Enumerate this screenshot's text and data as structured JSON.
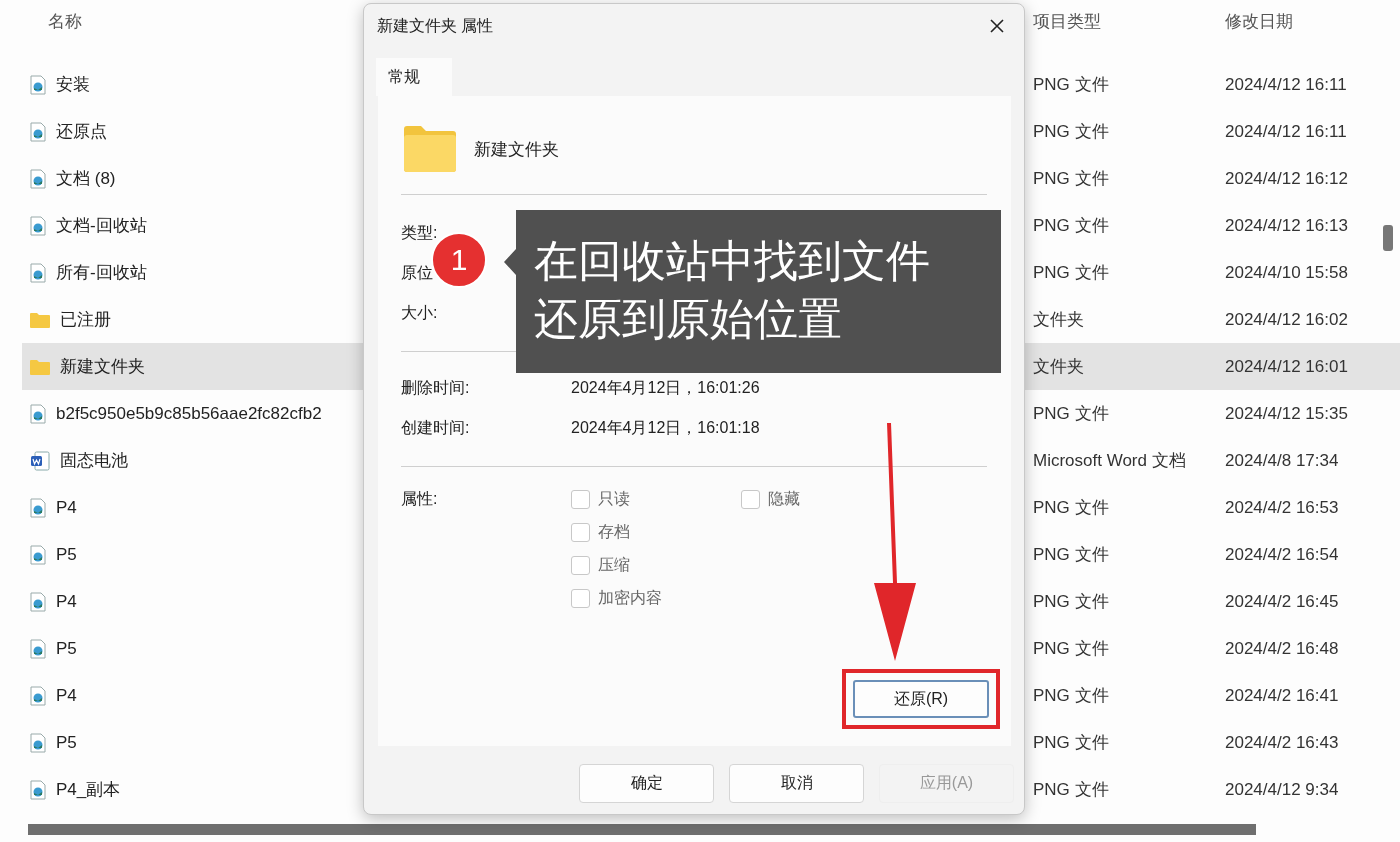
{
  "explorer": {
    "columns": [
      "名称",
      "项目类型",
      "修改日期"
    ],
    "rows": [
      {
        "name": "安装",
        "kind": "image",
        "type": "PNG 文件",
        "modified": "2024/4/12 16:11",
        "selected": false
      },
      {
        "name": "还原点",
        "kind": "image",
        "type": "PNG 文件",
        "modified": "2024/4/12 16:11",
        "selected": false
      },
      {
        "name": "文档 (8)",
        "kind": "image",
        "type": "PNG 文件",
        "modified": "2024/4/12 16:12",
        "selected": false
      },
      {
        "name": "文档-回收站",
        "kind": "image",
        "type": "PNG 文件",
        "modified": "2024/4/12 16:13",
        "selected": false
      },
      {
        "name": "所有-回收站",
        "kind": "image",
        "type": "PNG 文件",
        "modified": "2024/4/10 15:58",
        "selected": false
      },
      {
        "name": "已注册",
        "kind": "folder",
        "type": "文件夹",
        "modified": "2024/4/12 16:02",
        "selected": false
      },
      {
        "name": "新建文件夹",
        "kind": "folder",
        "type": "文件夹",
        "modified": "2024/4/12 16:01",
        "selected": true
      },
      {
        "name": "b2f5c950e5b9c85b56aae2fc82cfb2",
        "kind": "image",
        "type": "PNG 文件",
        "modified": "2024/4/12 15:35",
        "selected": false
      },
      {
        "name": "固态电池",
        "kind": "word",
        "type": "Microsoft Word 文档",
        "modified": "2024/4/8 17:34",
        "selected": false
      },
      {
        "name": "P4",
        "kind": "image",
        "type": "PNG 文件",
        "modified": "2024/4/2 16:53",
        "selected": false
      },
      {
        "name": "P5",
        "kind": "image",
        "type": "PNG 文件",
        "modified": "2024/4/2 16:54",
        "selected": false
      },
      {
        "name": "P4",
        "kind": "image",
        "type": "PNG 文件",
        "modified": "2024/4/2 16:45",
        "selected": false
      },
      {
        "name": "P5",
        "kind": "image",
        "type": "PNG 文件",
        "modified": "2024/4/2 16:48",
        "selected": false
      },
      {
        "name": "P4",
        "kind": "image",
        "type": "PNG 文件",
        "modified": "2024/4/2 16:41",
        "selected": false
      },
      {
        "name": "P5",
        "kind": "image",
        "type": "PNG 文件",
        "modified": "2024/4/2 16:43",
        "selected": false
      },
      {
        "name": "P4_副本",
        "kind": "image",
        "type": "PNG 文件",
        "modified": "2024/4/12 9:34",
        "selected": false
      }
    ]
  },
  "dialog": {
    "title": "新建文件夹 属性",
    "tabs": [
      {
        "label": "常规",
        "selected": true
      }
    ],
    "item_name": "新建文件夹",
    "info": [
      {
        "label": "类型:"
      },
      {
        "label": "原位"
      },
      {
        "label": "大小:"
      }
    ],
    "times": [
      {
        "label": "删除时间:",
        "value": "2024年4月12日，16:01:26"
      },
      {
        "label": "创建时间:",
        "value": "2024年4月12日，16:01:18"
      }
    ],
    "attributes_label": "属性:",
    "attributes": [
      {
        "label": "只读",
        "checked": false
      },
      {
        "label": "隐藏",
        "checked": false
      },
      {
        "label": "存档",
        "checked": false
      },
      {
        "label": "压缩",
        "checked": false
      },
      {
        "label": "加密内容",
        "checked": false
      }
    ],
    "restore_button": "还原(R)",
    "buttons": [
      {
        "label": "确定",
        "disabled": false
      },
      {
        "label": "取消",
        "disabled": false
      },
      {
        "label": "应用(A)",
        "disabled": true
      }
    ]
  },
  "annotation": {
    "step": "1",
    "lines": [
      "在回收站中找到文件",
      "还原到原始位置"
    ]
  }
}
